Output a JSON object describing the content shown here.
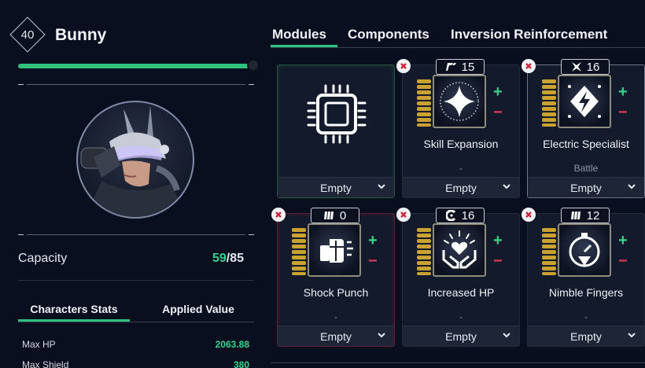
{
  "character": {
    "level": "40",
    "name": "Bunny",
    "hp_fraction": 0.99,
    "capacity_label": "Capacity",
    "capacity_used": "59",
    "capacity_sep": "/",
    "capacity_max": "85"
  },
  "stats": {
    "tabs": [
      "Characters Stats",
      "Applied Value"
    ],
    "rows": [
      {
        "label": "Max HP",
        "value": "2063.88"
      },
      {
        "label": "Max Shield",
        "value": "380"
      }
    ]
  },
  "tabs": [
    "Modules",
    "Components",
    "Inversion Reinforcement"
  ],
  "slots": [
    {
      "name": "",
      "sub": "",
      "footer": "Empty",
      "badge": "",
      "badge_icon": "",
      "icon": "chip-icon",
      "kind": "core-green"
    },
    {
      "name": "Skill Expansion",
      "sub": "-",
      "footer": "Empty",
      "badge": "15",
      "badge_icon": "slash-socket-icon",
      "icon": "sparkle-icon"
    },
    {
      "name": "Electric Specialist",
      "sub": "Battle",
      "footer": "Empty",
      "badge": "16",
      "badge_icon": "star-socket-icon",
      "icon": "lightning-icon"
    },
    {
      "name": "Shock Punch",
      "sub": "-",
      "footer": "Empty",
      "badge": "0",
      "badge_icon": "bars-socket-icon",
      "icon": "fist-icon"
    },
    {
      "name": "Increased HP",
      "sub": "-",
      "footer": "Empty",
      "badge": "16",
      "badge_icon": "c-socket-icon",
      "icon": "heart-hands-icon"
    },
    {
      "name": "Nimble Fingers",
      "sub": "-",
      "footer": "Empty",
      "badge": "12",
      "badge_icon": "bars-socket-icon",
      "icon": "stopwatch-icon"
    }
  ],
  "controls": {
    "plus": "+",
    "minus": "−"
  },
  "colors": {
    "accent": "#2ec27e",
    "positive": "#35d489",
    "negative": "#e23a55",
    "background": "#0a0f20"
  }
}
